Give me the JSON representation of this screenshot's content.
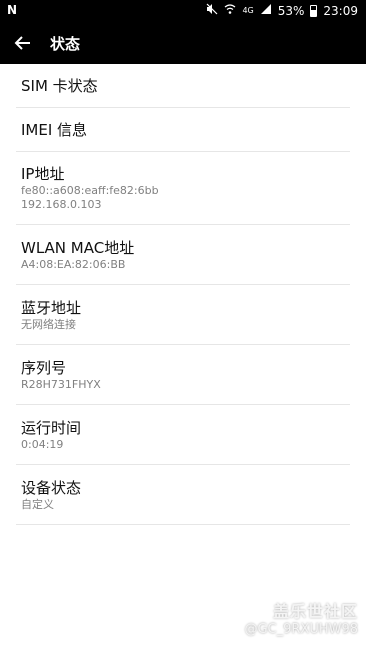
{
  "status_bar": {
    "left_glyph": "N",
    "network_type": "4G",
    "battery": "53%",
    "time": "23:09",
    "icons": [
      "mute-icon",
      "wifi-icon",
      "signal-icon",
      "battery-icon"
    ]
  },
  "app_bar": {
    "title": "状态",
    "back_icon": "arrow-left-icon"
  },
  "items": [
    {
      "title": "SIM 卡状态",
      "sub": ""
    },
    {
      "title": "IMEI 信息",
      "sub": ""
    },
    {
      "title": "IP地址",
      "sub1": "fe80::a608:eaff:fe82:6bb",
      "sub2": "192.168.0.103"
    },
    {
      "title": "WLAN MAC地址",
      "sub": "A4:08:EA:82:06:BB"
    },
    {
      "title": "蓝牙地址",
      "sub": "无网络连接"
    },
    {
      "title": "序列号",
      "sub": "R28H731FHYX"
    },
    {
      "title": "运行时间",
      "sub": "0:04:19"
    },
    {
      "title": "设备状态",
      "sub": "自定义"
    }
  ],
  "watermark": {
    "line1": "盖乐世社区",
    "line2": "@GC_9RXUHW98"
  }
}
